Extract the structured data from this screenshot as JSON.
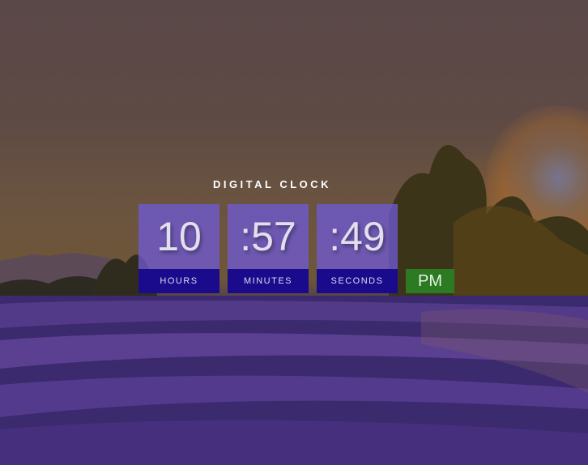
{
  "clock": {
    "title": "DIGITAL CLOCK",
    "hours": {
      "value": "10",
      "label": "HOURS"
    },
    "minutes": {
      "value": ":57",
      "label": "MINUTES"
    },
    "seconds": {
      "value": ":49",
      "label": "SECONDS"
    },
    "period": "PM"
  },
  "colors": {
    "value_box": "#6e5ad2",
    "label_box": "#1a0a8c",
    "period_box": "#2c7a22"
  },
  "background": {
    "scene": "lavender field at sunset"
  }
}
